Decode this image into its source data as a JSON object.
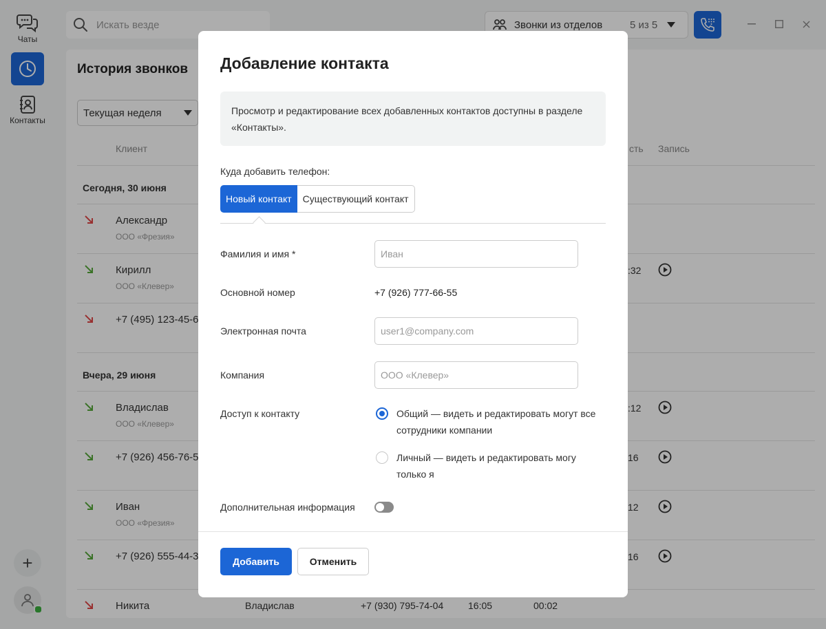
{
  "rail": {
    "chats_label": "Чаты",
    "contacts_label": "Контакты",
    "plus_label": "+"
  },
  "topbar": {
    "search_placeholder": "Искать везде",
    "dept_label": "Звонки из отделов",
    "dept_count": "5 из 5"
  },
  "history": {
    "title": "История звонков",
    "period": "Текущая неделя",
    "columns": {
      "client": "Клиент",
      "duration_partial": "сть",
      "record": "Запись"
    },
    "groups": [
      "Сегодня, 30 июня",
      "Вчера, 29 июня"
    ],
    "rows": [
      {
        "name": "Александр",
        "company": "ООО «Фрезия»",
        "type": "missed",
        "dur": ""
      },
      {
        "name": "Кирилл",
        "company": "ООО «Клевер»",
        "type": "incoming",
        "dur": ":32"
      },
      {
        "name": "+7 (495) 123-45-67",
        "company": "",
        "type": "missed",
        "dur": ""
      },
      {
        "name": "Владислав",
        "company": "ООО «Клевер»",
        "type": "incoming",
        "dur": ":12"
      },
      {
        "name": "+7 (926) 456-76-56",
        "company": "",
        "type": "incoming",
        "dur": "16"
      },
      {
        "name": "Иван",
        "company": "ООО «Фрезия»",
        "type": "incoming",
        "dur": "12"
      },
      {
        "name": "+7 (926) 555-44-33",
        "company": "",
        "type": "incoming",
        "dur": "16"
      }
    ],
    "last_row": {
      "name": "Никита",
      "employee": "Владислав",
      "phone": "+7 (930) 795-74-04",
      "time": "16:05",
      "duration": "00:02"
    }
  },
  "modal": {
    "title": "Добавление контакта",
    "info": "Просмотр и редактирование всех добавленных контактов доступны в разделе «Контакты».",
    "where_label": "Куда добавить телефон:",
    "tabs": {
      "new": "Новый контакт",
      "existing": "Существующий контакт"
    },
    "fields": {
      "name_label": "Фамилия и имя *",
      "name_placeholder": "Иван",
      "phone_label": "Основной номер",
      "phone_value": "+7 (926) 777-66-55",
      "email_label": "Электронная почта",
      "email_placeholder": "user1@company.com",
      "company_label": "Компания",
      "company_placeholder": "ООО «Клевер»",
      "access_label": "Доступ к контакту",
      "access_public": "Общий — видеть и редактировать могут все сотрудники компании",
      "access_private": "Личный — видеть и редактировать могу только я",
      "extra_label": "Дополнительная информация"
    },
    "buttons": {
      "add": "Добавить",
      "cancel": "Отменить"
    }
  },
  "colors": {
    "accent": "#1c66d6",
    "missed": "#e04848",
    "incoming": "#56a83a"
  }
}
